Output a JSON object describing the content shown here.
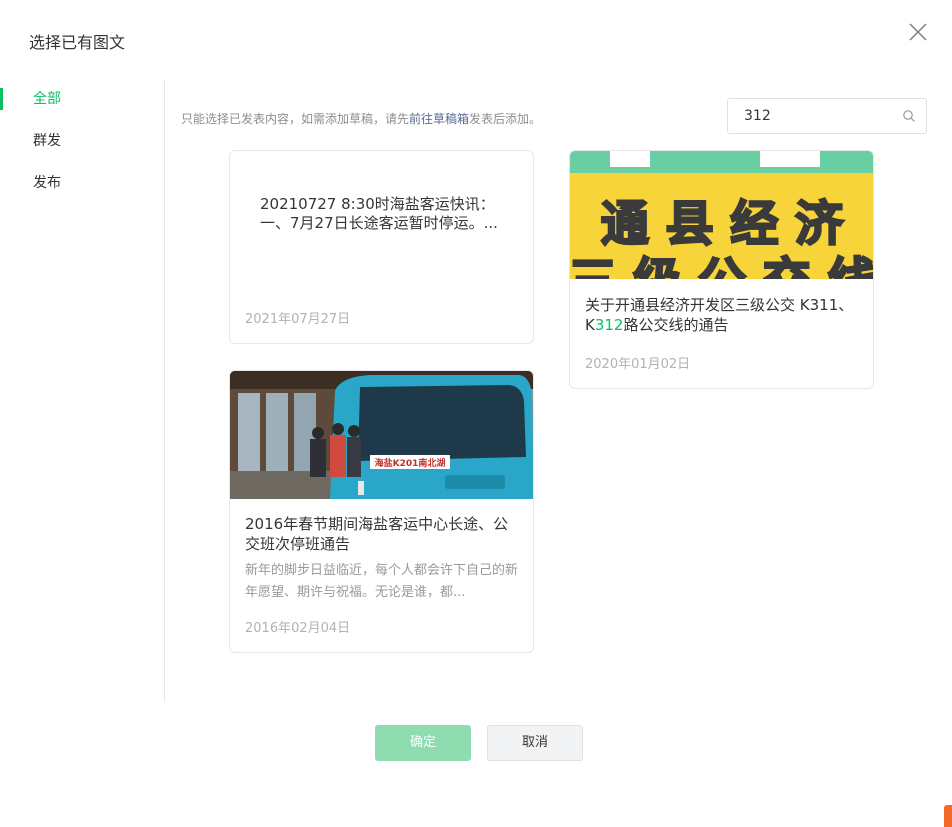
{
  "dialog": {
    "title": "选择已有图文"
  },
  "sidebar": {
    "items": [
      {
        "label": "全部",
        "active": true
      },
      {
        "label": "群发",
        "active": false
      },
      {
        "label": "发布",
        "active": false
      }
    ]
  },
  "tip": {
    "prefix": "只能选择已发表内容，如需添加草稿，请先",
    "link": "前往草稿箱",
    "suffix": "发表后添加。"
  },
  "search": {
    "value": "312"
  },
  "cards": [
    {
      "text_line1": "20210727    8:30时海盐客运快讯：",
      "text_line2": "一、7月27日长途客运暂时停运。...",
      "date": "2021年07月27日"
    },
    {
      "title_pre": "关于开通县经济开发区三级公交 K311、K",
      "title_hl": "312",
      "title_post": "路公交线的通告",
      "cover_text_top": "通  县  经  济",
      "cover_text_bottom": "三  级  公  交  线",
      "date": "2020年01月02日"
    },
    {
      "title": "2016年春节期间海盐客运中心长途、公交班次停班通告",
      "desc": "新年的脚步日益临近，每个人都会许下自己的新年愿望、期许与祝福。无论是谁，都...",
      "bus_sign": "海盐K201南北湖",
      "date": "2016年02月04日"
    }
  ],
  "buttons": {
    "ok": "确定",
    "cancel": "取消"
  },
  "colors": {
    "accent": "#07c160",
    "link": "#576b95",
    "ok_disabled": "#8fdcb0"
  }
}
